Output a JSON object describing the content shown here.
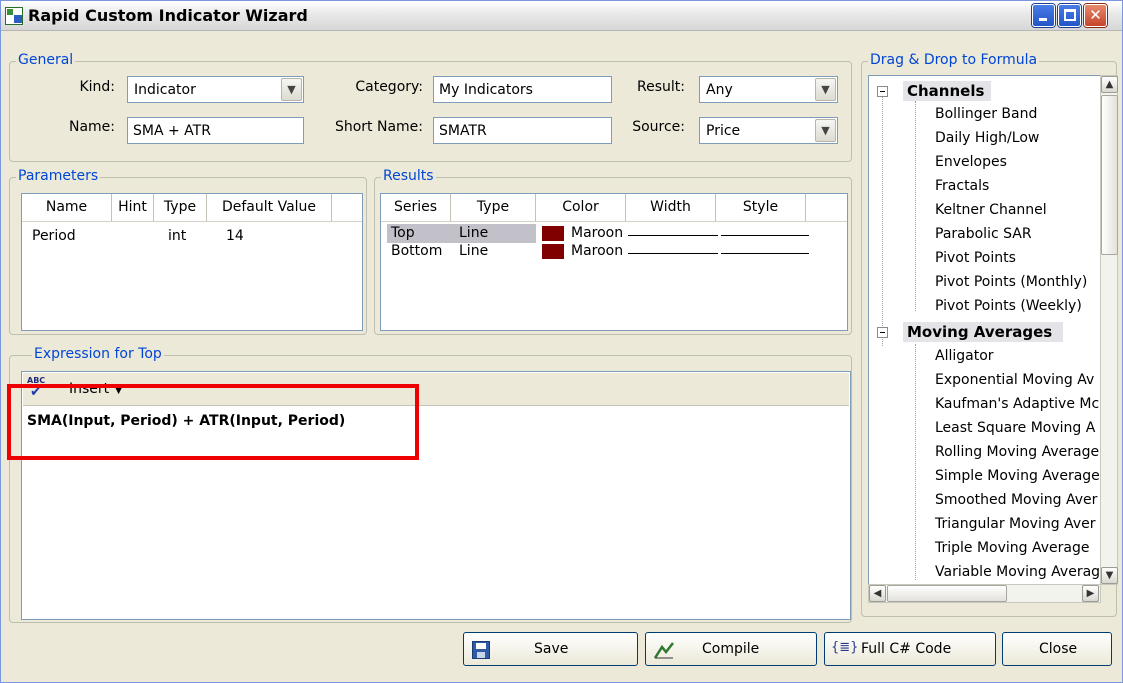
{
  "window": {
    "title": "Rapid Custom Indicator Wizard"
  },
  "general": {
    "title": "General",
    "kind_label": "Kind:",
    "kind_value": "Indicator",
    "name_label": "Name:",
    "name_value": "SMA + ATR",
    "category_label": "Category:",
    "category_value": "My Indicators",
    "short_name_label": "Short Name:",
    "short_name_value": "SMATR",
    "result_label": "Result:",
    "result_value": "Any",
    "source_label": "Source:",
    "source_value": "Price"
  },
  "parameters": {
    "title": "Parameters",
    "columns": [
      "Name",
      "Hint",
      "Type",
      "Default Value"
    ],
    "rows": [
      {
        "name": "Period",
        "hint": "",
        "type": "int",
        "default": "14"
      }
    ]
  },
  "results": {
    "title": "Results",
    "columns": [
      "Series",
      "Type",
      "Color",
      "Width",
      "Style"
    ],
    "rows": [
      {
        "series": "Top",
        "type": "Line",
        "color_name": "Maroon",
        "color_hex": "#800000",
        "selected": true
      },
      {
        "series": "Bottom",
        "type": "Line",
        "color_name": "Maroon",
        "color_hex": "#800000",
        "selected": false
      }
    ]
  },
  "expression": {
    "title": "Expression for Top",
    "insert_label": "Insert",
    "spellcheck_label": "ABC",
    "code": "SMA(Input, Period) + ATR(Input, Period)"
  },
  "formula_tree": {
    "title": "Drag & Drop to Formula",
    "categories": [
      {
        "name": "Channels",
        "items": [
          "Bollinger Band",
          "Daily High/Low",
          "Envelopes",
          "Fractals",
          "Keltner Channel",
          "Parabolic SAR",
          "Pivot Points",
          "Pivot Points (Monthly)",
          "Pivot Points (Weekly)"
        ]
      },
      {
        "name": "Moving Averages",
        "items": [
          "Alligator",
          "Exponential Moving Av",
          "Kaufman's Adaptive Mc",
          "Least Square Moving A",
          "Rolling Moving Average",
          "Simple Moving Average",
          "Smoothed Moving Aver",
          "Triangular Moving Aver",
          "Triple Moving Average",
          "Variable Moving Averag"
        ]
      }
    ]
  },
  "buttons": {
    "save": "Save",
    "compile": "Compile",
    "full_code": "Full C# Code",
    "close": "Close"
  },
  "colors": {
    "accent_title": "#0046d5",
    "highlight": "#ee0000",
    "maroon": "#800000"
  },
  "icons": [
    "app-icon",
    "minimize-icon",
    "maximize-icon",
    "close-icon",
    "dropdown-arrow-icon",
    "spellcheck-icon",
    "save-icon",
    "compile-icon",
    "code-icon",
    "expander-minus-icon"
  ]
}
